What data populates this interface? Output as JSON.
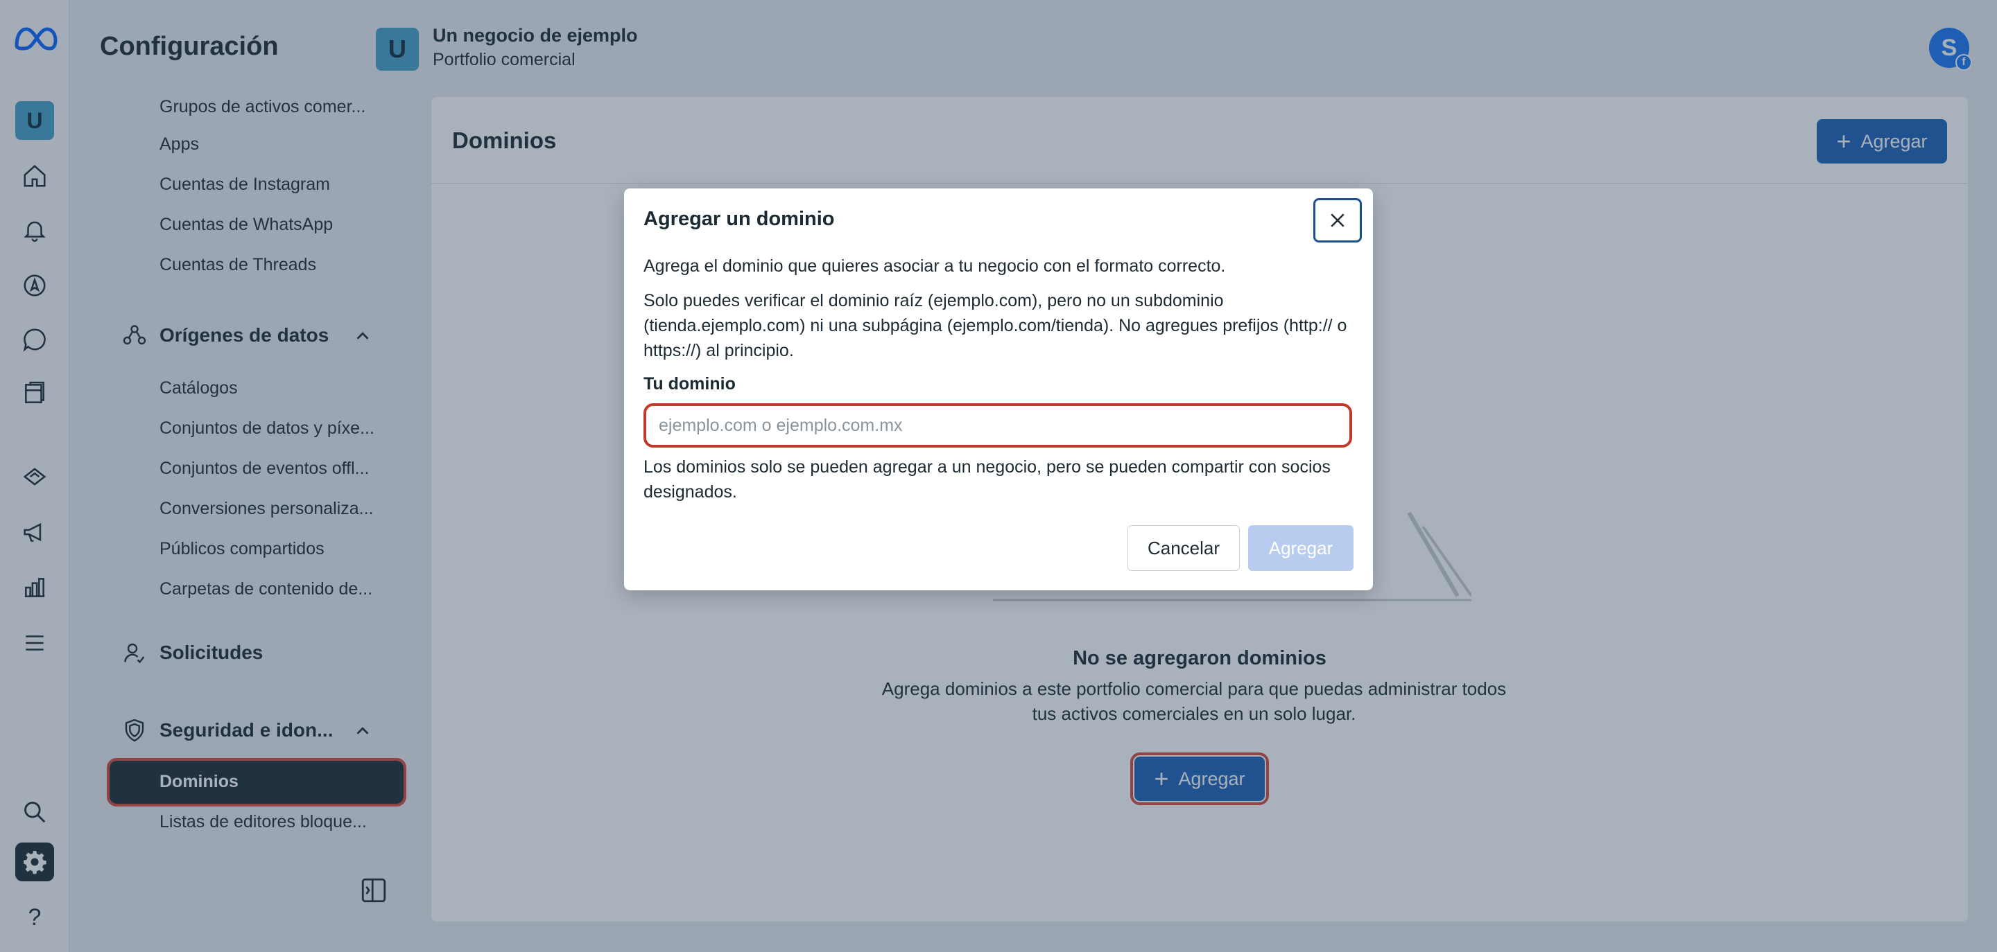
{
  "header": {
    "title": "Configuración",
    "business_initial": "U",
    "business_name": "Un negocio de ejemplo",
    "business_subtitle": "Portfolio comercial",
    "user_initial": "S"
  },
  "rail": {
    "avatar_initial": "U"
  },
  "sidebar": {
    "items_top": [
      "Grupos de activos comer...",
      "Apps",
      "Cuentas de Instagram",
      "Cuentas de WhatsApp",
      "Cuentas de Threads"
    ],
    "data_sources_label": "Orígenes de datos",
    "data_sources_items": [
      "Catálogos",
      "Conjuntos de datos y píxe...",
      "Conjuntos de eventos offl...",
      "Conversiones personaliza...",
      "Públicos compartidos",
      "Carpetas de contenido de..."
    ],
    "requests_label": "Solicitudes",
    "security_label": "Seguridad e idon...",
    "active_item": "Dominios",
    "blocked_lists": "Listas de editores bloque..."
  },
  "main": {
    "title": "Dominios",
    "add_label": "Agregar",
    "empty_title": "No se agregaron dominios",
    "empty_text": "Agrega dominios a este portfolio comercial para que puedas administrar todos tus activos comerciales en un solo lugar.",
    "empty_add_label": "Agregar"
  },
  "modal": {
    "title": "Agregar un dominio",
    "intro": "Agrega el dominio que quieres asociar a tu negocio con el formato correcto.",
    "rules": "Solo puedes verificar el dominio raíz (ejemplo.com), pero no un subdominio (tienda.ejemplo.com) ni una subpágina (ejemplo.com/tienda). No agregues prefijos (http:// o https://) al principio.",
    "field_label": "Tu dominio",
    "field_placeholder": "ejemplo.com o ejemplo.com.mx",
    "field_value": "",
    "note": "Los dominios solo se pueden agregar a un negocio, pero se pueden compartir con socios designados.",
    "cancel_label": "Cancelar",
    "add_label": "Agregar"
  }
}
